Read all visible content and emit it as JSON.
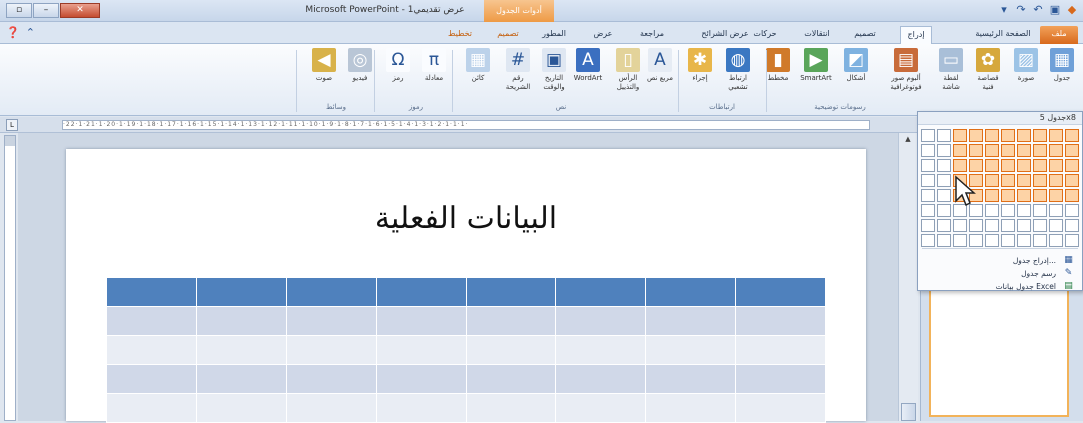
{
  "window": {
    "title": "Microsoft PowerPoint - عرض تقديمي1",
    "contextual_tab_group": "أدوات الجدول",
    "minimize_label": "–",
    "restore_label": "▫",
    "close_label": "✕"
  },
  "qat": [
    {
      "icon": "file-menu-icon"
    },
    {
      "icon": "save-icon"
    },
    {
      "icon": "undo-icon"
    },
    {
      "icon": "redo-icon"
    },
    {
      "icon": "customize-qat-icon"
    }
  ],
  "tabs": [
    {
      "label": "ملف",
      "kind": "file"
    },
    {
      "label": "الصفحة الرئيسية"
    },
    {
      "label": "إدراج",
      "active": true
    },
    {
      "label": "تصميم"
    },
    {
      "label": "انتقالات"
    },
    {
      "label": "حركات"
    },
    {
      "label": "عرض الشرائح"
    },
    {
      "label": "مراجعة"
    },
    {
      "label": "عرض"
    },
    {
      "label": "المطور"
    },
    {
      "label": "تصميم",
      "kind": "context"
    },
    {
      "label": "تخطيط",
      "kind": "context"
    }
  ],
  "ribbon": {
    "buttons": [
      {
        "label": "جدول",
        "icon": "table-icon",
        "glyph": "▦",
        "color": "#6fa0d8"
      },
      {
        "label": "صورة",
        "icon": "picture-icon",
        "glyph": "▨",
        "color": "#9cc3e6"
      },
      {
        "label": "قصاصة فنية",
        "icon": "clipart-icon",
        "glyph": "✿",
        "color": "#d6a83d"
      },
      {
        "label": "لقطة شاشة",
        "icon": "screenshot-icon",
        "glyph": "▭",
        "color": "#a9bfd8"
      },
      {
        "label": "ألبوم صور فوتوغرافية",
        "icon": "photo-album-icon",
        "glyph": "▤",
        "color": "#c86b3a"
      },
      {
        "label": "أشكال",
        "icon": "shapes-icon",
        "glyph": "◩",
        "color": "#7fb2e0"
      },
      {
        "label": "SmartArt",
        "icon": "smartart-icon",
        "glyph": "▶",
        "color": "#5aa55a"
      },
      {
        "label": "مخطط",
        "icon": "chart-icon",
        "glyph": "▮",
        "color": "#d07a2a"
      },
      {
        "label": "ارتباط تشعبي",
        "icon": "hyperlink-icon",
        "glyph": "◍",
        "color": "#3b78c2"
      },
      {
        "label": "إجراء",
        "icon": "action-icon",
        "glyph": "✱",
        "color": "#e8b64a"
      },
      {
        "label": "مربع نص",
        "icon": "textbox-icon",
        "glyph": "A",
        "color": "#e6ecf4"
      },
      {
        "label": "الرأس والتذييل",
        "icon": "header-footer-icon",
        "glyph": "▯",
        "color": "#e3d39a"
      },
      {
        "label": "WordArt",
        "icon": "wordart-icon",
        "glyph": "A",
        "color": "#3b6fc0"
      },
      {
        "label": "التاريخ والوقت",
        "icon": "date-time-icon",
        "glyph": "▣",
        "color": "#dfe7f2"
      },
      {
        "label": "رقم الشريحة",
        "icon": "slide-number-icon",
        "glyph": "#",
        "color": "#dfe7f2"
      },
      {
        "label": "كائن",
        "icon": "object-icon",
        "glyph": "▦",
        "color": "#bcd2ea"
      },
      {
        "label": "معادلة",
        "icon": "equation-icon",
        "glyph": "π",
        "color": "#fafcff"
      },
      {
        "label": "رمز",
        "icon": "symbol-icon",
        "glyph": "Ω",
        "color": "#fafcff"
      },
      {
        "label": "فيديو",
        "icon": "video-icon",
        "glyph": "◎",
        "color": "#b9c6d6"
      },
      {
        "label": "صوت",
        "icon": "audio-icon",
        "glyph": "◀",
        "color": "#d8b24a"
      }
    ],
    "groups": [
      {
        "label": "رسومات توضيحية"
      },
      {
        "label": "ارتباطات"
      },
      {
        "label": "نص"
      },
      {
        "label": "رموز"
      },
      {
        "label": "وسائط"
      }
    ]
  },
  "ruler": {
    "text": "·22·1·21·1·20·1·19·1·18·1·17·1·16·1·15·1·14·1·13·1·12·1·11·1·10·1·9·1·8·1·7·1·6·1·5·1·4·1·3·1·2·1·1·1·"
  },
  "slide": {
    "title": "البيانات الفعلية",
    "table_rows": 5,
    "table_cols": 8
  },
  "dropdown": {
    "header": "جدول 5x8",
    "grid_cols": 10,
    "grid_rows": 8,
    "selected_cols": 8,
    "selected_rows": 5,
    "items": [
      {
        "label": "إدراج جدول...",
        "icon": "insert-table-icon",
        "glyph": "▦"
      },
      {
        "label": "رسم جدول",
        "icon": "draw-table-icon",
        "glyph": "✎"
      },
      {
        "label": "جدول بيانات Excel",
        "icon": "excel-table-icon",
        "glyph": "▤"
      }
    ]
  },
  "colors": {
    "accent": "#4f81bd",
    "selection": "#e06f17"
  }
}
